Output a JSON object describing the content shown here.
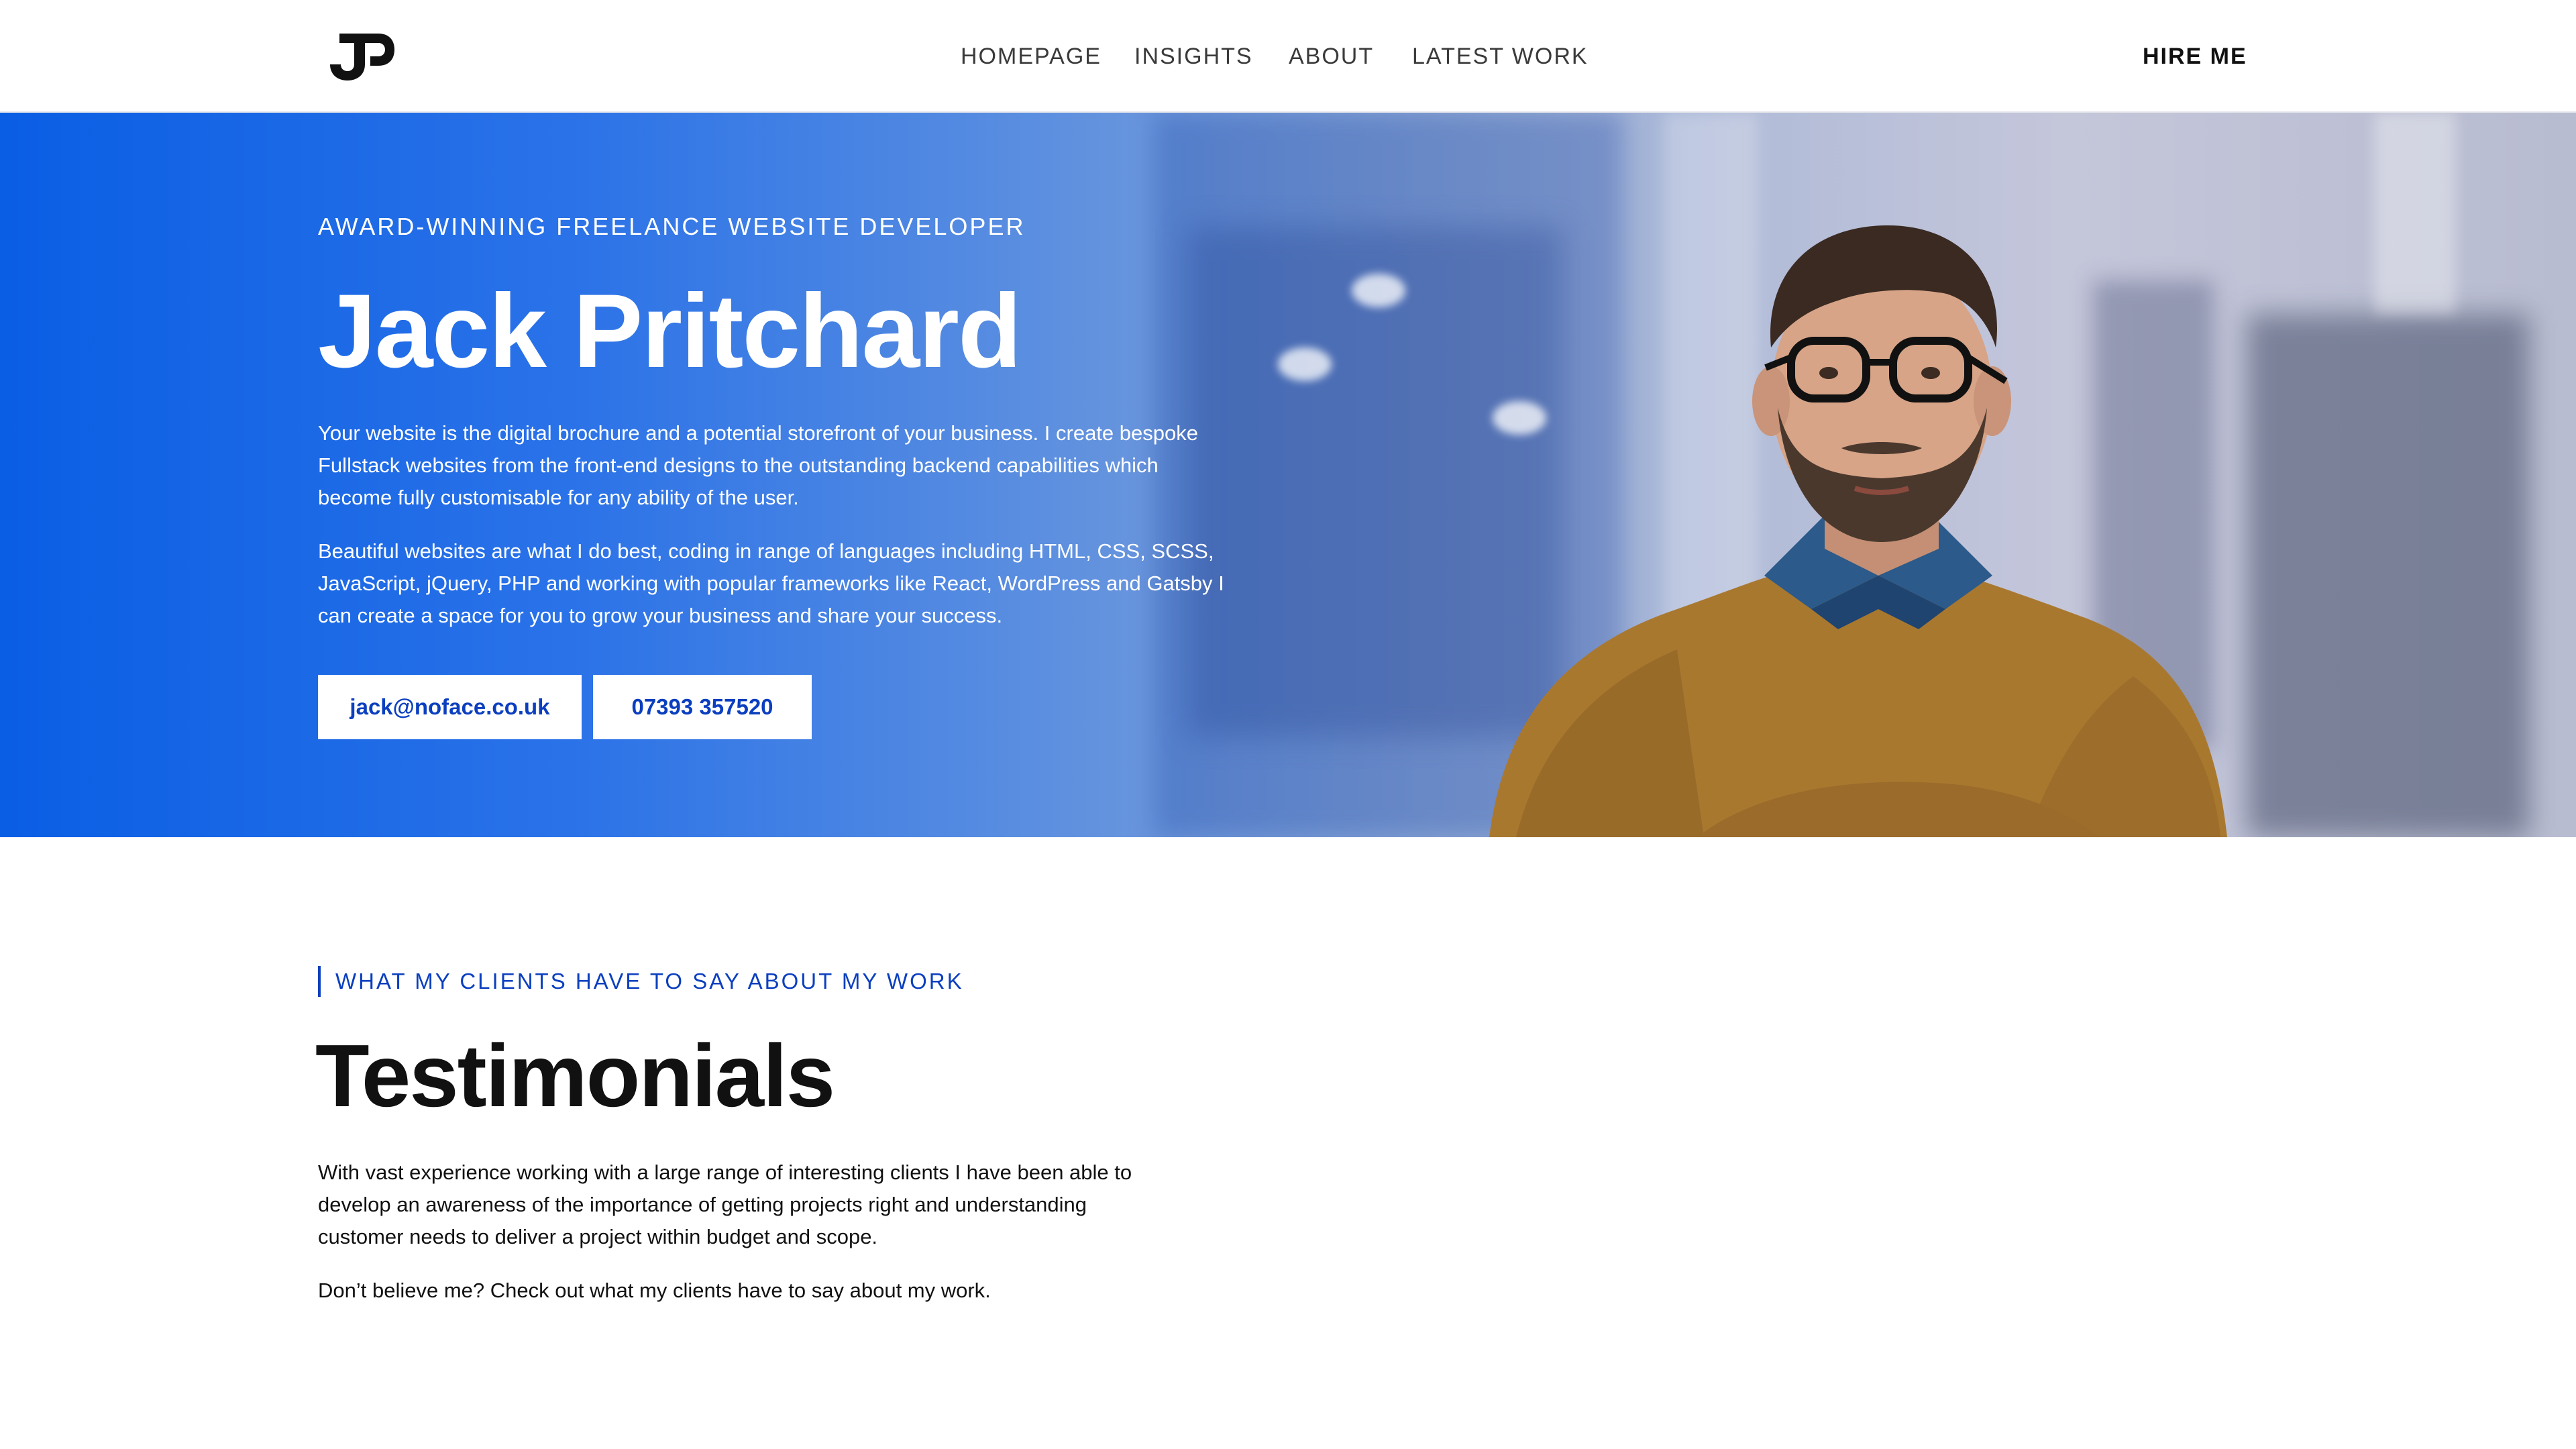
{
  "header": {
    "logo_text": "JP",
    "nav": [
      "HOMEPAGE",
      "INSIGHTS",
      "ABOUT",
      "LATEST WORK"
    ],
    "cta": "HIRE ME"
  },
  "hero": {
    "eyebrow": "AWARD-WINNING FREELANCE WEBSITE DEVELOPER",
    "name": "Jack Pritchard",
    "paragraph_1": "Your website is the digital brochure and a potential storefront of your business. I create bespoke Fullstack websites from the front-end designs to the outstanding backend capabilities which become fully customisable for any ability of the user.",
    "paragraph_2": "Beautiful websites are what I do best, coding in range of languages including HTML, CSS, SCSS, JavaScript, jQuery, PHP and working with popular frameworks like React, WordPress and Gatsby I can create a space for you to grow your business and share your success.",
    "email_button": "jack@noface.co.uk",
    "phone_button": "07393 357520"
  },
  "testimonials": {
    "kicker": "WHAT MY CLIENTS HAVE TO SAY ABOUT MY WORK",
    "title": "Testimonials",
    "paragraph_1": "With vast experience working with a large range of interesting clients I have been able to develop an awareness of the importance of getting projects right and understanding customer needs to deliver a project within budget and scope.",
    "paragraph_2": "Don’t believe me? Check out what my clients have to say about my work."
  },
  "colors": {
    "accent": "#0b3fbf",
    "hero_blue": "#0a5ee4",
    "text": "#111111",
    "sweater": "#a9782f",
    "collar": "#2c5a8a"
  },
  "icons": {
    "logo": "jp-monogram-icon"
  }
}
